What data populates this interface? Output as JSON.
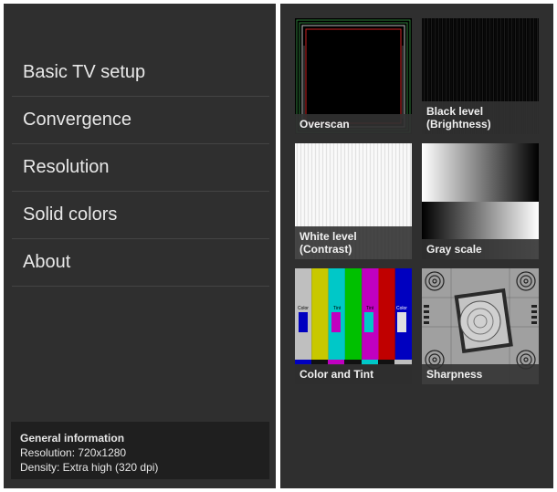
{
  "menu": {
    "items": [
      {
        "label": "Basic TV setup"
      },
      {
        "label": "Convergence"
      },
      {
        "label": "Resolution"
      },
      {
        "label": "Solid colors"
      },
      {
        "label": "About"
      }
    ]
  },
  "info": {
    "title": "General information",
    "resolution": "Resolution: 720x1280",
    "density": "Density: Extra high (320 dpi)"
  },
  "tiles": [
    {
      "label": "Overscan"
    },
    {
      "label": "Black level\n(Brightness)"
    },
    {
      "label": "White level (Contrast)"
    },
    {
      "label": "Gray scale"
    },
    {
      "label": "Color and Tint"
    },
    {
      "label": "Sharpness"
    }
  ],
  "color_bar_labels": {
    "color": "Color",
    "tint1": "Tint",
    "tint2": "Tint",
    "color2": "Color"
  },
  "colors": {
    "panel": "#2f2f2f",
    "caption": "#333333"
  }
}
